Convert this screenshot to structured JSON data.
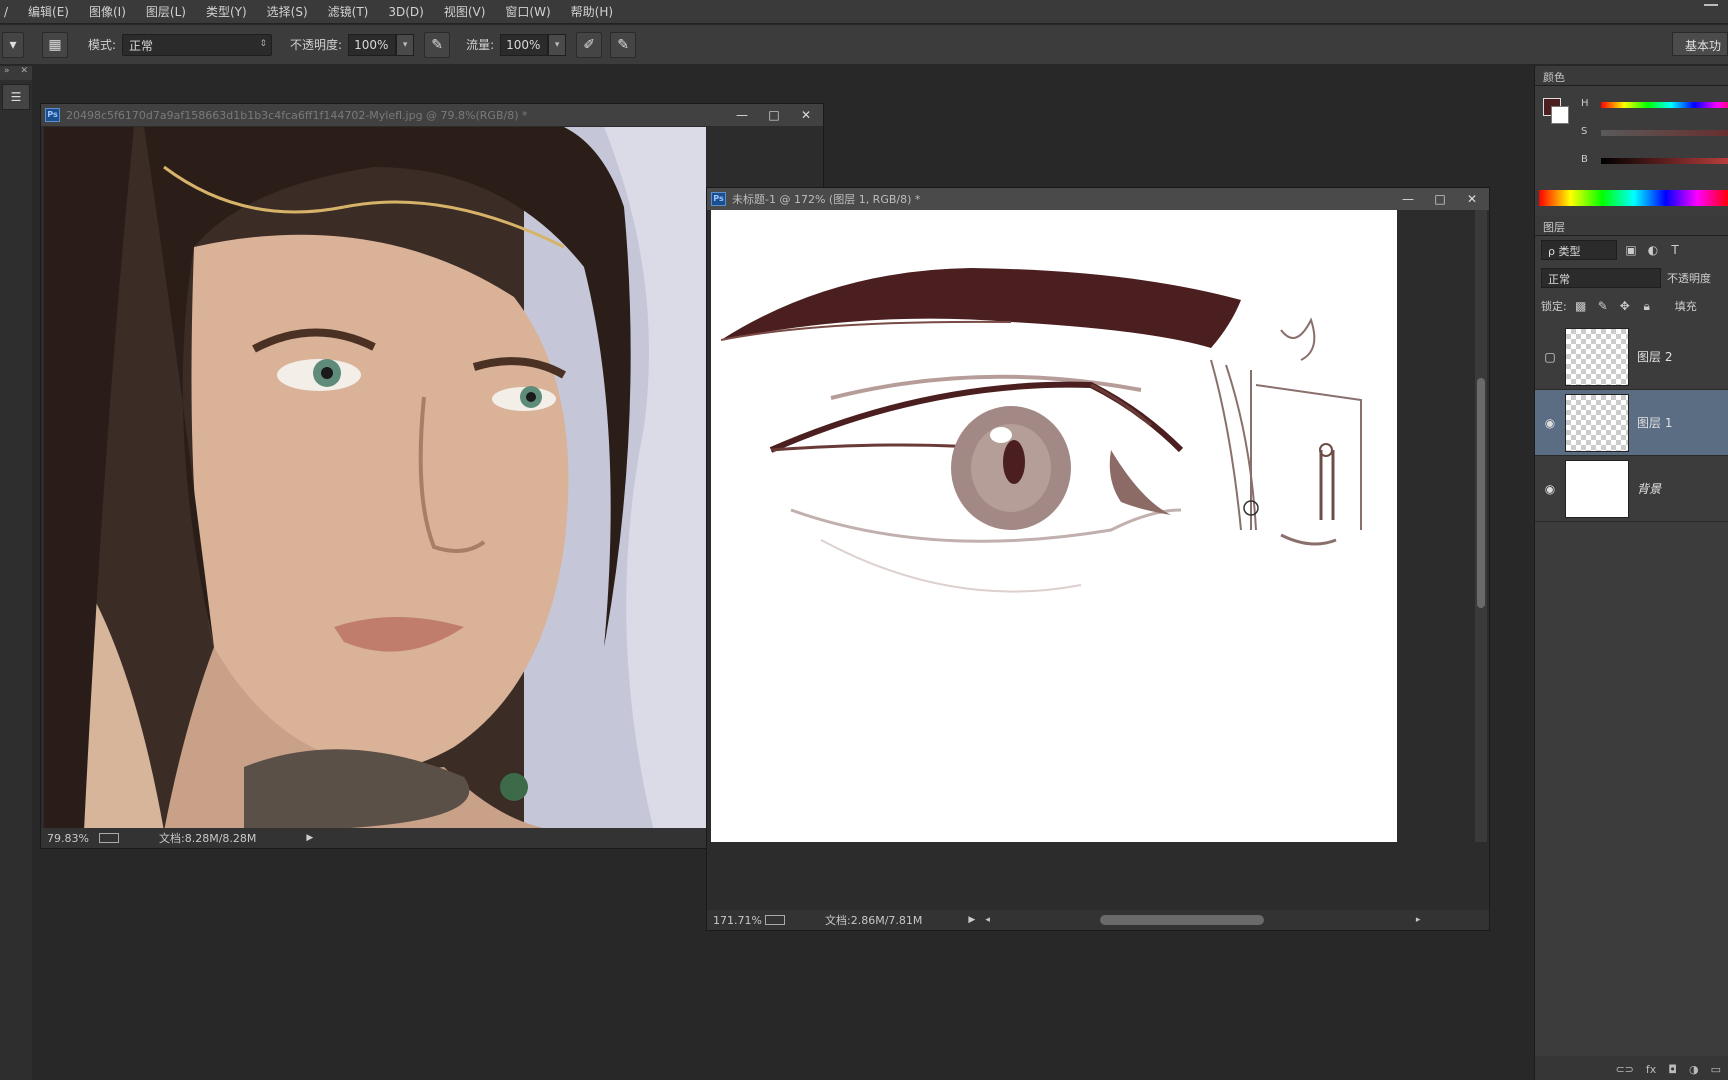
{
  "menu": {
    "items": [
      "/",
      "编辑(E)",
      "图像(I)",
      "图层(L)",
      "类型(Y)",
      "选择(S)",
      "滤镜(T)",
      "3D(D)",
      "视图(V)",
      "窗口(W)",
      "帮助(H)"
    ]
  },
  "options": {
    "mode_label": "模式:",
    "mode_value": "正常",
    "opacity_label": "不透明度:",
    "opacity_value": "100%",
    "flow_label": "流量:",
    "flow_value": "100%",
    "workspace_label": "基本功"
  },
  "ref_window": {
    "title": "20498c5f6170d7a9af158663d1b1b3c4fca6ff1f144702-Mylefl.jpg @ 79.8%(RGB/8) *",
    "zoom": "79.83%",
    "doc_info": "文档:8.28M/8.28M"
  },
  "canvas_window": {
    "title": "未标题-1 @ 172% (图层 1, RGB/8) *",
    "zoom": "171.71%",
    "doc_info": "文档:2.86M/7.81M"
  },
  "color_panel": {
    "tab": "颜色",
    "h_label": "H",
    "s_label": "S",
    "b_label": "B",
    "fg_color": "#4b1f1f",
    "bg_color": "#ffffff"
  },
  "layers_panel": {
    "tab": "图层",
    "filter_label": "ρ 类型",
    "blend_mode": "正常",
    "opacity_label": "不透明度",
    "lock_label": "锁定:",
    "fill_label": "填充",
    "layers": [
      {
        "name": "图层 2",
        "visible": false,
        "selected": false
      },
      {
        "name": "图层 1",
        "visible": true,
        "selected": true
      },
      {
        "name": "背景",
        "visible": true,
        "selected": false
      }
    ],
    "bottom_icons": [
      "link-icon",
      "fx-icon",
      "mask-icon",
      "adjustment-icon",
      "folder-icon"
    ]
  },
  "colors": {
    "accent_selected": "#5b6d83",
    "brush": "#4b1f1f"
  }
}
